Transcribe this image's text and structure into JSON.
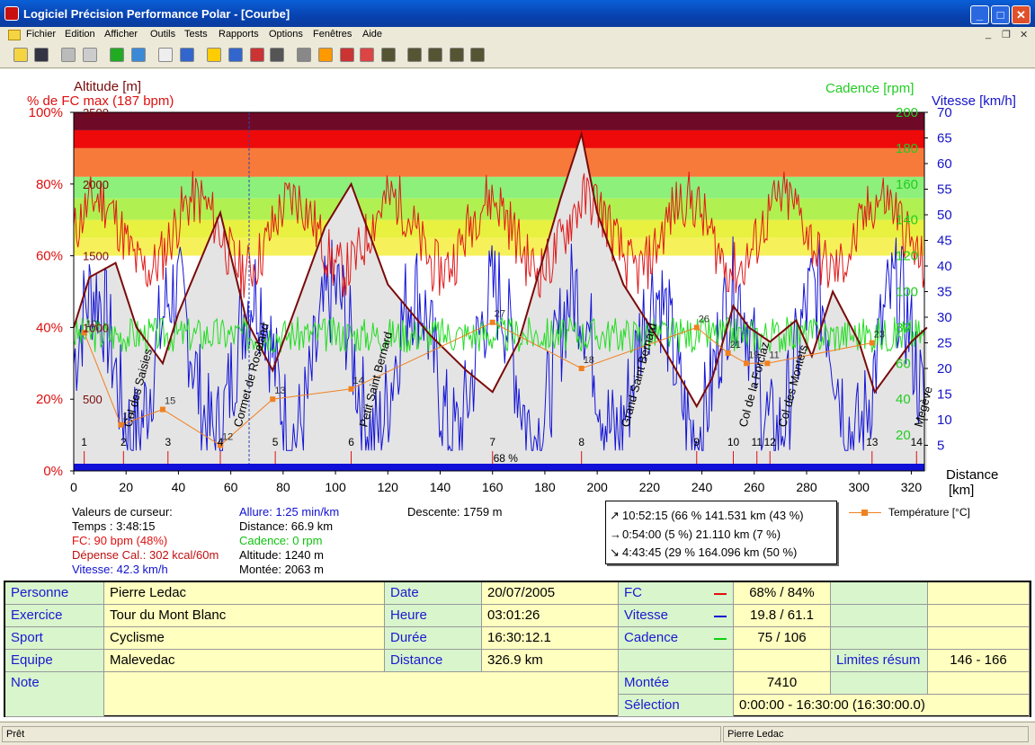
{
  "window": {
    "title": "Logiciel Précision Performance Polar - [Courbe]",
    "min": "_",
    "max": "□",
    "close": "✕"
  },
  "menu": [
    "Fichier",
    "Edition",
    "Afficher",
    "Outils",
    "Tests",
    "Rapports",
    "Options",
    "Fenêtres",
    "Aide"
  ],
  "mdi": {
    "min": "_",
    "restore": "❐",
    "close": "✕"
  },
  "toolbar_icons": [
    "open-icon",
    "save-icon",
    "print-icon",
    "copy-icon",
    "refresh-icon",
    "globe-icon",
    "table-icon",
    "book-icon",
    "curve-icon",
    "histogram-icon",
    "zone-icon",
    "grid-icon",
    "zoom-icon",
    "heart-curve-icon",
    "transfer-icon",
    "compare-icon",
    "chart1-icon",
    "chart2-icon",
    "chart3-icon",
    "chart4-icon",
    "chart5-icon"
  ],
  "axes": {
    "left_title1": "Altitude [m]",
    "left_title2": "% de FC max (187 bpm)",
    "right_title1": "Cadence [rpm]",
    "right_title2": "Vitesse [km/h]",
    "pct_ticks": [
      "100%",
      "80%",
      "60%",
      "40%",
      "20%",
      "0%"
    ],
    "alt_ticks": [
      "2500",
      "2000",
      "1500",
      "1000",
      "500"
    ],
    "cad_ticks": [
      "200",
      "180",
      "160",
      "140",
      "120",
      "100",
      "80",
      "60",
      "40",
      "20"
    ],
    "vit_ticks": [
      "70",
      "65",
      "60",
      "55",
      "50",
      "45",
      "40",
      "35",
      "30",
      "25",
      "20",
      "15",
      "10",
      "5"
    ],
    "x_ticks": [
      "0",
      "20",
      "40",
      "60",
      "80",
      "100",
      "120",
      "140",
      "160",
      "180",
      "200",
      "220",
      "240",
      "260",
      "280",
      "300",
      "320"
    ],
    "x_title1": "Distance",
    "x_title2": "[km]"
  },
  "chart_data": {
    "type": "line",
    "xlabel": "Distance [km]",
    "xlim": [
      0,
      325
    ],
    "ylim_pct": [
      0,
      100
    ],
    "ylim_alt": [
      0,
      2500
    ],
    "ylim_vit": [
      0,
      70
    ],
    "ylim_cad": [
      0,
      200
    ],
    "altitude_profile": {
      "x": [
        0,
        6,
        16,
        24,
        34,
        40,
        56,
        66,
        76,
        96,
        106,
        120,
        136,
        150,
        160,
        170,
        186,
        194,
        200,
        210,
        224,
        238,
        244,
        252,
        258,
        266,
        276,
        282,
        290,
        300,
        306,
        320,
        326
      ],
      "y": [
        1000,
        1350,
        1450,
        1000,
        750,
        1100,
        1800,
        1050,
        700,
        1700,
        2000,
        1300,
        950,
        700,
        550,
        900,
        1900,
        2350,
        1800,
        1300,
        900,
        450,
        650,
        1150,
        1000,
        900,
        1050,
        800,
        1250,
        900,
        550,
        900,
        1000
      ]
    },
    "temperature_markers": {
      "labels": [
        "10",
        "27",
        "18",
        "26",
        "21",
        "19",
        "11",
        "23",
        "12",
        "13",
        "14",
        "15",
        "17"
      ],
      "points": [
        [
          4,
          25
        ],
        [
          160,
          27
        ],
        [
          194,
          18
        ],
        [
          238,
          26
        ],
        [
          250,
          21
        ],
        [
          257,
          19
        ],
        [
          265,
          19
        ],
        [
          305,
          23
        ],
        [
          56,
          3
        ],
        [
          76,
          12
        ],
        [
          106,
          14
        ],
        [
          34,
          10
        ],
        [
          18,
          7
        ]
      ]
    },
    "segments": [
      "1",
      "2",
      "3",
      "4",
      "5",
      "6",
      "7",
      "8",
      "9",
      "10",
      "11",
      "12",
      "13",
      "14"
    ],
    "climbs": [
      "Col des Saisies",
      "Cormet de Roseland",
      "Petit Saint Bernard",
      "Grand Saint Bernard",
      "Col de la Forclaz",
      "Col des Montets",
      "Megève"
    ],
    "zone_pct": "68 %"
  },
  "cursor": {
    "label": "Valeurs de curseur:",
    "temps": "Temps : 3:48:15",
    "fc": "FC: 90 bpm (48%)",
    "cal": "Dépense Cal.: 302 kcal/60m",
    "vitesse": "Vitesse: 42.3 km/h",
    "allure": "Allure: 1:25 min/km",
    "distance": "Distance: 66.9 km",
    "cadence": "Cadence: 0 rpm",
    "altitude": "Altitude: 1240 m",
    "montee": "Montée: 2063 m",
    "descente": "Descente: 1759 m"
  },
  "statbox": {
    "r1": "10:52:15  (66 % 141.531 km  (43 %)",
    "r2": "0:54:00   (5 %)  21.110 km   (7 %)",
    "r3": "4:43:45  (29 % 164.096 km  (50 %)",
    "a1": "↗",
    "a2": "→",
    "a3": "↘"
  },
  "legend": {
    "label": "Température [°C]"
  },
  "info": {
    "personne_h": "Personne",
    "personne": "Pierre Ledac",
    "exercice_h": "Exercice",
    "exercice": "Tour du Mont Blanc",
    "sport_h": "Sport",
    "sport": "Cyclisme",
    "equipe_h": "Equipe",
    "equipe": "Malevedac",
    "note_h": "Note",
    "date_h": "Date",
    "date": "20/07/2005",
    "heure_h": "Heure",
    "heure": "03:01:26",
    "duree_h": "Durée",
    "duree": "16:30:12.1",
    "distance_h": "Distance",
    "distance": "326.9 km",
    "fc_h": "FC",
    "fc": "68% / 84%",
    "vitesse_h": "Vitesse",
    "vitesse": "19.8 / 61.1",
    "cadence_h": "Cadence",
    "cadence": "75 / 106",
    "limites_h": "Limites résum",
    "limites": "146 - 166",
    "montee_h": "Montée",
    "montee": "7410",
    "selection_h": "Sélection",
    "selection": "0:00:00 - 16:30:00 (16:30:00.0)"
  },
  "status": {
    "left": "Prêt",
    "right": "Pierre Ledac"
  }
}
